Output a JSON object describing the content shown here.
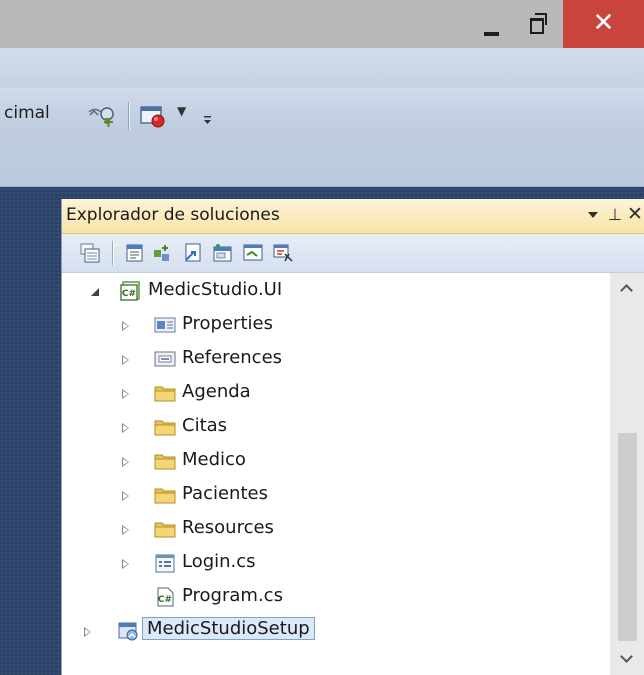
{
  "window": {
    "controls": {
      "minimize": "minimize",
      "restore": "restore",
      "close": "close"
    }
  },
  "toolbar": {
    "partial_label": "cimal",
    "icons": [
      "search-binoculars-icon",
      "breakpoint-icon",
      "dropdown-arrow-icon",
      "toolbar-overflow-icon"
    ]
  },
  "solution_explorer": {
    "title": "Explorador de soluciones",
    "header_controls": [
      "window-position-dropdown-icon",
      "pin-icon",
      "close-icon"
    ],
    "tree": {
      "project": {
        "label": "MedicStudio.UI",
        "expanded": true,
        "icon": "csharp-project-icon"
      },
      "items": [
        {
          "label": "Properties",
          "icon": "properties-icon",
          "expandable": true
        },
        {
          "label": "References",
          "icon": "references-icon",
          "expandable": true
        },
        {
          "label": "Agenda",
          "icon": "folder-icon",
          "expandable": true
        },
        {
          "label": "Citas",
          "icon": "folder-icon",
          "expandable": true
        },
        {
          "label": "Medico",
          "icon": "folder-icon",
          "expandable": true
        },
        {
          "label": "Pacientes",
          "icon": "folder-icon",
          "expandable": true
        },
        {
          "label": "Resources",
          "icon": "folder-icon",
          "expandable": true
        },
        {
          "label": "Login.cs",
          "icon": "form-file-icon",
          "expandable": true
        },
        {
          "label": "Program.cs",
          "icon": "csharp-file-icon",
          "expandable": false
        }
      ],
      "setup_project": {
        "label": "MedicStudioSetup",
        "selected": true,
        "icon": "setup-project-icon"
      }
    }
  },
  "colors": {
    "title_bar": "#b9b9b9",
    "close_button": "#c9443d",
    "panel_header": "#f8e4a8",
    "workspace": "#2c4266",
    "folder": "#e8c452"
  }
}
